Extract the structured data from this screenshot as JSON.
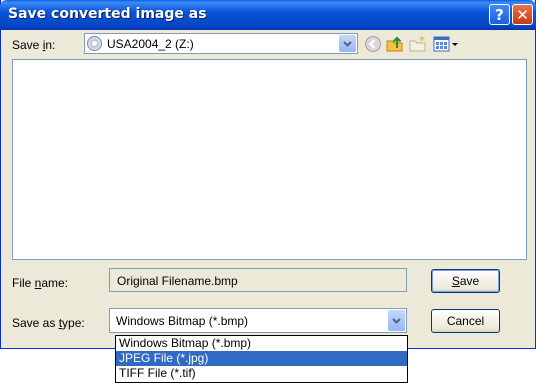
{
  "window": {
    "title": "Save converted image as"
  },
  "title_buttons": {
    "help": "?",
    "close": "✕"
  },
  "save_in": {
    "label_before": "Save ",
    "label_access": "i",
    "label_after": "n:",
    "value": "USA2004_2 (Z:)",
    "icon": "cd-drive-icon"
  },
  "toolbar": [
    "back-icon",
    "up-folder-icon",
    "new-folder-icon",
    "views-menu-icon"
  ],
  "file_name": {
    "label_before": "File ",
    "label_access": "n",
    "label_after": "ame:",
    "value": "Original Filename.bmp"
  },
  "save_type": {
    "label_before": "Save as ",
    "label_access": "t",
    "label_after": "ype:",
    "value": "Windows Bitmap (*.bmp)"
  },
  "buttons": {
    "save_access": "S",
    "save_rest": "ave",
    "cancel": "Cancel"
  },
  "dropdown": {
    "options": [
      "Windows Bitmap (*.bmp)",
      "JPEG File (*.jpg)",
      "TIFF File (*.tif)"
    ],
    "selected_index": 1
  },
  "colors": {
    "title_bar": "#0a53d8",
    "selection": "#316ac5",
    "dialog_bg": "#ece9d8"
  }
}
